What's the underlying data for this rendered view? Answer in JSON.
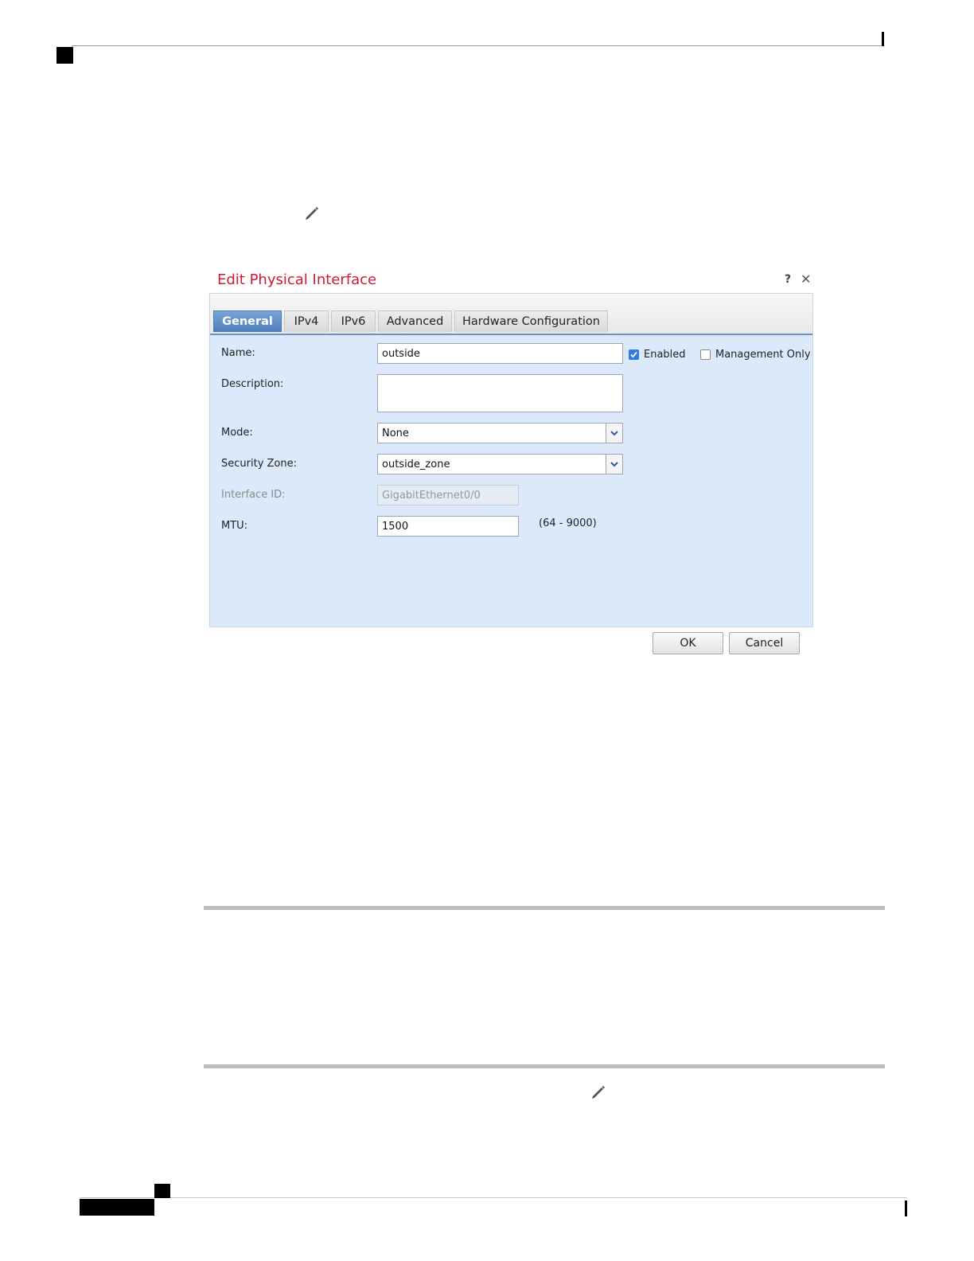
{
  "page_icons": {
    "top_pencil": "pencil-icon",
    "bottom_pencil": "pencil-icon"
  },
  "dialog": {
    "title": "Edit Physical Interface",
    "help_label": "?",
    "close_label": "✕",
    "tabs": [
      {
        "label": "General",
        "active": true
      },
      {
        "label": "IPv4",
        "active": false
      },
      {
        "label": "IPv6",
        "active": false
      },
      {
        "label": "Advanced",
        "active": false
      },
      {
        "label": "Hardware Configuration",
        "active": false
      }
    ],
    "fields": {
      "name": {
        "label": "Name:",
        "value": "outside"
      },
      "enabled": {
        "label": "Enabled",
        "checked": true
      },
      "management_only": {
        "label": "Management Only",
        "checked": false
      },
      "description": {
        "label": "Description:",
        "value": ""
      },
      "mode": {
        "label": "Mode:",
        "value": "None"
      },
      "security_zone": {
        "label": "Security Zone:",
        "value": "outside_zone"
      },
      "interface_id": {
        "label": "Interface ID:",
        "value": "GigabitEthernet0/0"
      },
      "mtu": {
        "label": "MTU:",
        "value": "1500",
        "range": "(64 - 9000)"
      }
    },
    "buttons": {
      "ok": "OK",
      "cancel": "Cancel"
    },
    "colors": {
      "title": "#cc1a37",
      "panel": "#dbe9fb",
      "active_tab": "#4d7dbd"
    }
  }
}
